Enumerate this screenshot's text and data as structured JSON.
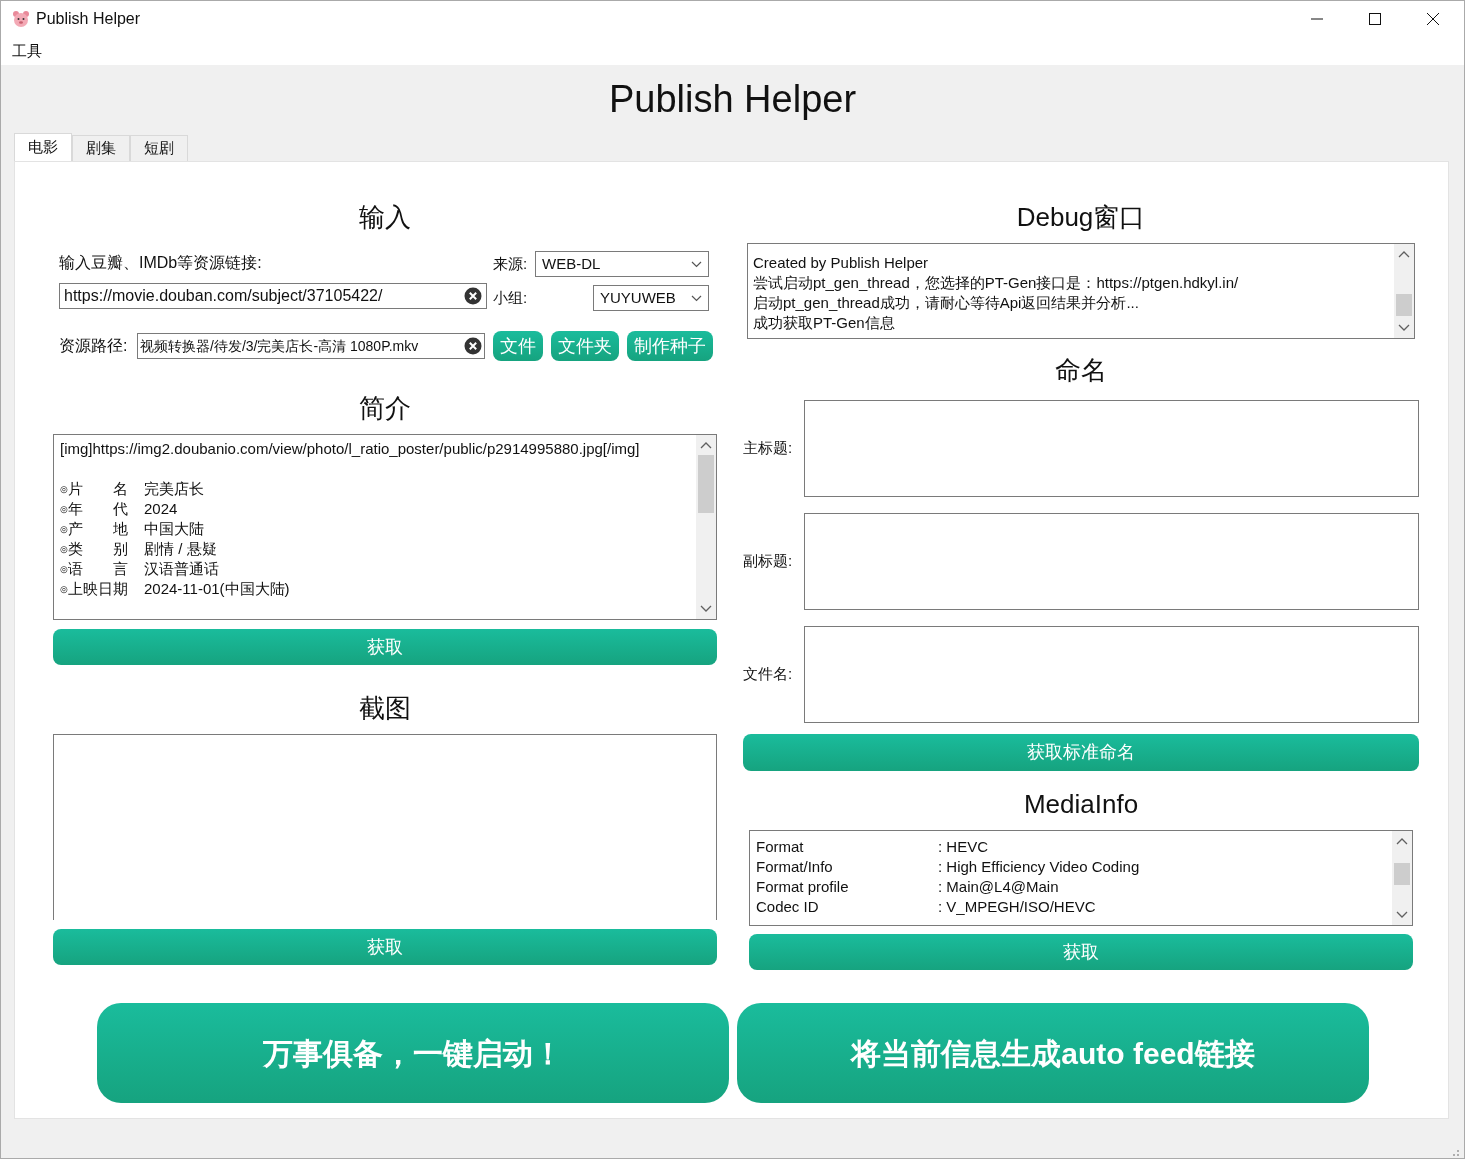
{
  "window": {
    "title": "Publish Helper"
  },
  "menu": [
    "工具"
  ],
  "app_title": "Publish Helper",
  "tabs": [
    {
      "label": "电影",
      "selected": true
    },
    {
      "label": "剧集",
      "selected": false
    },
    {
      "label": "短剧",
      "selected": false
    }
  ],
  "input": {
    "heading": "输入",
    "link_label": "输入豆瓣、IMDb等资源链接:",
    "link_value": "https://movie.douban.com/subject/37105422/",
    "source_label": "来源:",
    "source_value": "WEB-DL",
    "group_label": "小组:",
    "group_value": "YUYUWEB",
    "path_label": "资源路径:",
    "path_value": "视频转换器/待发/3/完美店长-高清 1080P.mkv",
    "buttons": [
      "文件",
      "文件夹",
      "制作种子"
    ]
  },
  "summary": {
    "heading": "简介",
    "first_line": "[img]https://img2.doubanio.com/view/photo/l_ratio_poster/public/p2914995880.jpg[/img]",
    "rows": [
      {
        "label": "片　　名",
        "value": "完美店长"
      },
      {
        "label": "年　　代",
        "value": "2024"
      },
      {
        "label": "产　　地",
        "value": "中国大陆"
      },
      {
        "label": "类　　别",
        "value": "剧情 / 悬疑"
      },
      {
        "label": "语　　言",
        "value": "汉语普通话"
      },
      {
        "label": "上映日期",
        "value": "2024-11-01(中国大陆)"
      }
    ],
    "bullet": "◎",
    "button": "获取"
  },
  "screenshots": {
    "heading": "截图",
    "button": "获取"
  },
  "debug": {
    "heading": "Debug窗口",
    "lines": [
      "Created by Publish Helper",
      "尝试启动pt_gen_thread，您选择的PT-Gen接口是：https://ptgen.hdkyl.in/",
      "启动pt_gen_thread成功，请耐心等待Api返回结果并分析...",
      "成功获取PT-Gen信息"
    ]
  },
  "naming": {
    "heading": "命名",
    "fields": [
      {
        "label": "主标题:"
      },
      {
        "label": "副标题:"
      },
      {
        "label": "文件名:"
      }
    ],
    "button": "获取标准命名"
  },
  "mediainfo": {
    "heading": "MediaInfo",
    "rows": [
      {
        "key": "Format",
        "value": ": HEVC"
      },
      {
        "key": "Format/Info",
        "value": ": High Efficiency Video Coding"
      },
      {
        "key": "Format profile",
        "value": ": Main@L4@Main"
      },
      {
        "key": "Codec ID",
        "value": ": V_MPEGH/ISO/HEVC"
      }
    ],
    "button": "获取"
  },
  "actions": [
    "万事俱备，一键启动！",
    "将当前信息生成auto feed链接"
  ]
}
